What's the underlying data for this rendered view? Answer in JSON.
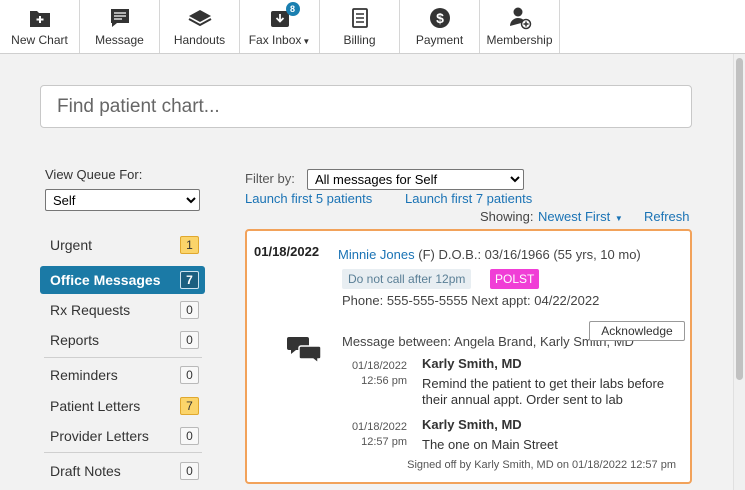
{
  "toolbar": {
    "items": [
      {
        "label": "New Chart",
        "icon": "new-chart-icon"
      },
      {
        "label": "Message",
        "icon": "message-icon"
      },
      {
        "label": "Handouts",
        "icon": "handouts-icon"
      },
      {
        "label": "Fax Inbox",
        "icon": "fax-inbox-icon",
        "badge": "8"
      },
      {
        "label": "Billing",
        "icon": "billing-icon"
      },
      {
        "label": "Payment",
        "icon": "payment-icon"
      },
      {
        "label": "Membership",
        "icon": "membership-icon"
      }
    ]
  },
  "search": {
    "placeholder": "Find patient chart..."
  },
  "queue": {
    "label": "View Queue For:",
    "selected": "Self",
    "items": [
      {
        "label": "Urgent",
        "count": "1",
        "highlight": true
      },
      {
        "label": "Office Messages",
        "count": "7",
        "active": true
      },
      {
        "label": "Rx Requests",
        "count": "0"
      },
      {
        "label": "Reports",
        "count": "0"
      },
      {
        "label": "Reminders",
        "count": "0"
      },
      {
        "label": "Patient Letters",
        "count": "7",
        "highlight": true
      },
      {
        "label": "Provider Letters",
        "count": "0"
      },
      {
        "label": "Draft Notes",
        "count": "0"
      }
    ]
  },
  "filter": {
    "label": "Filter by:",
    "selected": "All messages for Self",
    "launch5": "Launch first 5 patients",
    "launch7": "Launch first 7 patients",
    "showing_label": "Showing:",
    "sort": "Newest First",
    "refresh": "Refresh"
  },
  "message": {
    "date": "01/18/2022",
    "patient_name": "Minnie Jones",
    "patient_info": "(F)  D.O.B.: 03/16/1966 (55 yrs, 10 mo)",
    "note_tag": "Do not call after 12pm",
    "polst_tag": "POLST",
    "phone_line": "Phone: 555-555-5555 Next appt: 04/22/2022",
    "between": "Message between: Angela Brand, Karly Smith, MD",
    "acknowledge": "Acknowledge",
    "entries": [
      {
        "date": "01/18/2022",
        "time": "12:56 pm",
        "author": "Karly Smith, MD",
        "text": "Remind the patient to get their labs before their annual appt. Order sent to lab"
      },
      {
        "date": "01/18/2022",
        "time": "12:57 pm",
        "author": "Karly Smith, MD",
        "text": "The one on Main Street"
      }
    ],
    "signed": "Signed off by Karly Smith, MD on 01/18/2022 12:57 pm"
  },
  "colors": {
    "accent": "#1b7aa6",
    "card_border": "#f2a25a",
    "polst": "#f03ed6",
    "link": "#1a73b5"
  }
}
